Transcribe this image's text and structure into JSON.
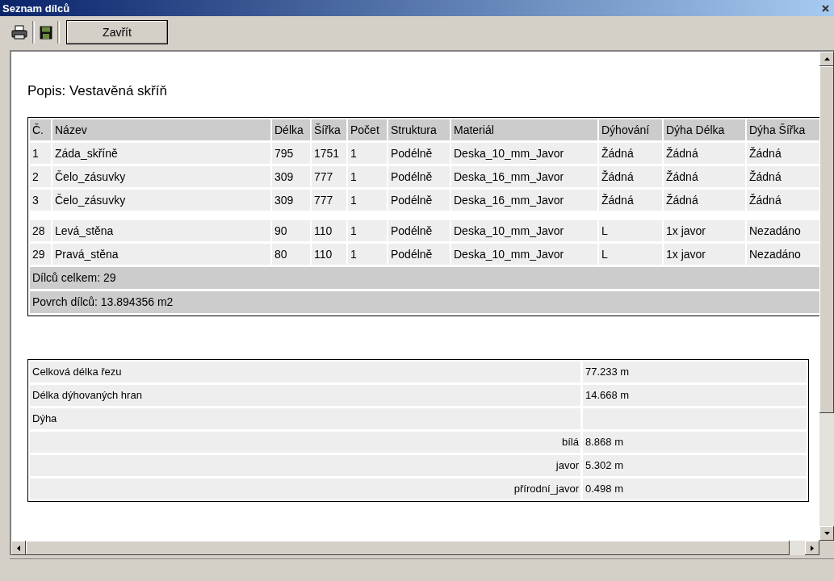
{
  "window": {
    "title": "Seznam dílců"
  },
  "toolbar": {
    "close_label": "Zavřít"
  },
  "description": "Popis: Vestavěná skříň",
  "table": {
    "columns": [
      "Č.",
      "Název",
      "Délka",
      "Šířka",
      "Počet",
      "Struktura",
      "Materiál",
      "Dýhování",
      "Dýha Délka",
      "Dýha Šířka"
    ],
    "row_groups": [
      [
        [
          "1",
          "Záda_skříně",
          "795",
          "1751",
          "1",
          "Podélně",
          "Deska_10_mm_Javor",
          "Žádná",
          "Žádná",
          "Žádná"
        ],
        [
          "2",
          "Čelo_zásuvky",
          "309",
          "777",
          "1",
          "Podélně",
          "Deska_16_mm_Javor",
          "Žádná",
          "Žádná",
          "Žádná"
        ],
        [
          "3",
          "Čelo_zásuvky",
          "309",
          "777",
          "1",
          "Podélně",
          "Deska_16_mm_Javor",
          "Žádná",
          "Žádná",
          "Žádná"
        ]
      ],
      [
        [
          "28",
          "Levá_stěna",
          "90",
          "110",
          "1",
          "Podélně",
          "Deska_10_mm_Javor",
          "L",
          "1x javor",
          "Nezadáno"
        ],
        [
          "29",
          "Pravá_stěna",
          "80",
          "110",
          "1",
          "Podélně",
          "Deska_10_mm_Javor",
          "L",
          "1x javor",
          "Nezadáno"
        ]
      ]
    ],
    "footer": [
      "Dílců celkem: 29",
      "Povrch dílců: 13.894356 m2"
    ]
  },
  "summary": [
    {
      "kind": "left",
      "label": "Celková délka řezu",
      "value": "77.233 m"
    },
    {
      "kind": "left",
      "label": "Délka dýhovaných hran",
      "value": "14.668 m"
    },
    {
      "kind": "left",
      "label": "Dýha"
    },
    {
      "kind": "right",
      "label": "bílá",
      "value": "8.868 m"
    },
    {
      "kind": "right",
      "label": "javor",
      "value": "5.302 m"
    },
    {
      "kind": "right",
      "label": "přírodní_javor",
      "value": "0.498 m"
    }
  ]
}
